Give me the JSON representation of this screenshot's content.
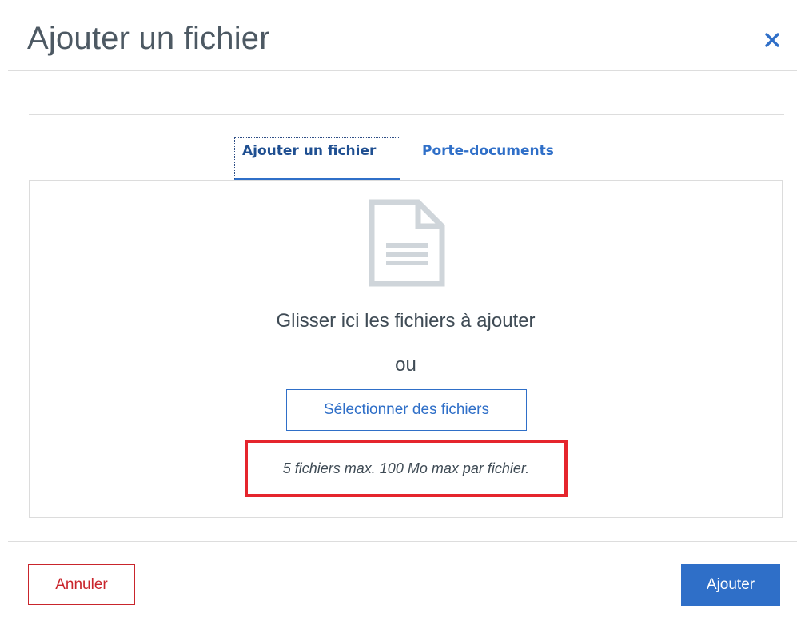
{
  "dialog": {
    "title": "Ajouter un fichier",
    "close_icon": "close-icon"
  },
  "tabs": [
    {
      "label": "Ajouter un fichier",
      "active": true
    },
    {
      "label": "Porte-documents",
      "active": false
    }
  ],
  "upload": {
    "file_icon": "document-icon",
    "drop_text": "Glisser ici les fichiers à ajouter",
    "or_text": "ou",
    "select_button_label": "Sélectionner des fichiers",
    "limits_text": "5 fichiers max. 100 Mo max par fichier."
  },
  "footer": {
    "cancel_label": "Annuler",
    "add_label": "Ajouter"
  },
  "colors": {
    "accent": "#2f6fc8",
    "danger": "#c9252c",
    "highlight_box": "#e5252d",
    "icon_gray": "#cfd5da",
    "text": "#3f4b55"
  }
}
